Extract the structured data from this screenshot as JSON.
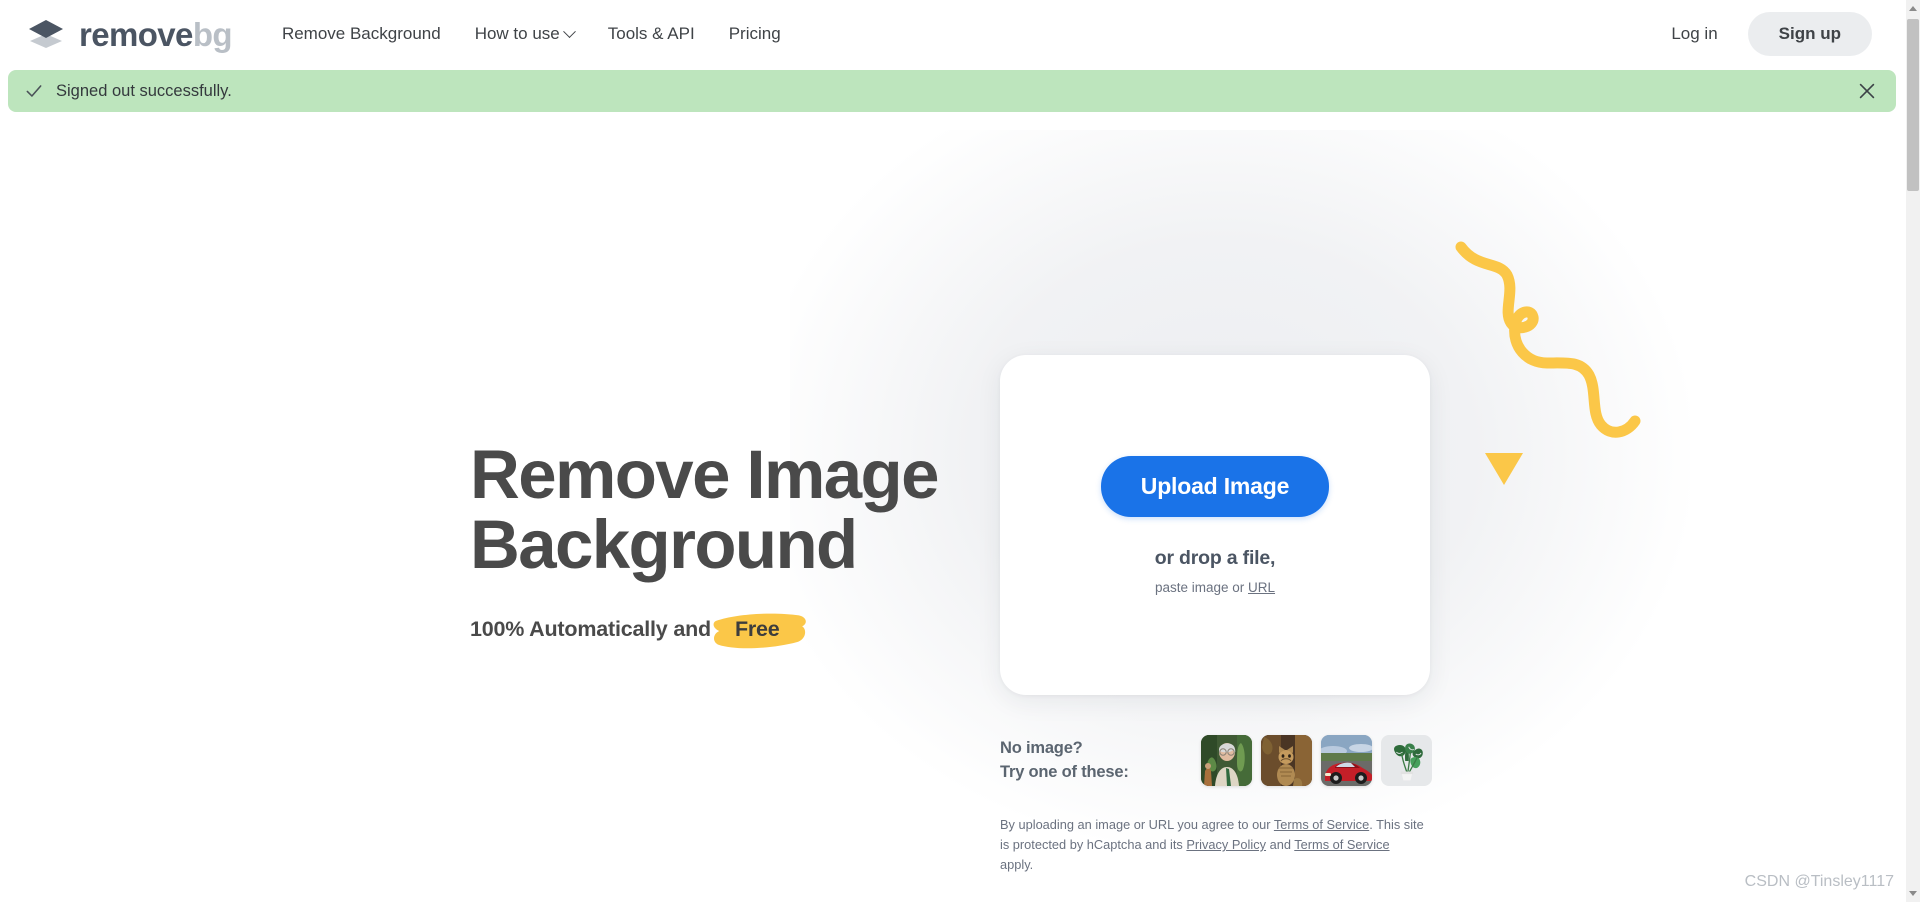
{
  "header": {
    "logo": {
      "icon": "layers-diamond-icon",
      "text_primary": "remove",
      "text_secondary": "bg"
    },
    "nav": [
      {
        "label": "Remove Background",
        "has_chevron": false
      },
      {
        "label": "How to use",
        "has_chevron": true
      },
      {
        "label": "Tools & API",
        "has_chevron": false
      },
      {
        "label": "Pricing",
        "has_chevron": false
      }
    ],
    "login_label": "Log in",
    "signup_label": "Sign up"
  },
  "flash": {
    "icon": "check-icon",
    "message": "Signed out successfully.",
    "close_icon": "close-icon",
    "background_color": "#bde5bd"
  },
  "hero": {
    "title_line1": "Remove Image",
    "title_line2": "Background",
    "subtitle_prefix": "100% Automatically and",
    "badge_label": "Free",
    "badge_color": "#fbc748"
  },
  "upload": {
    "button_label": "Upload Image",
    "button_color": "#1a73e8",
    "drop_text": "or drop a file,",
    "paste_prefix": "paste image or ",
    "paste_link": "URL"
  },
  "samples": {
    "label_line1": "No image?",
    "label_line2": "Try one of these:",
    "thumbnails": [
      {
        "name": "sample-man-thumbnail",
        "alt": "man in garden"
      },
      {
        "name": "sample-cat-thumbnail",
        "alt": "cat beside tree"
      },
      {
        "name": "sample-car-thumbnail",
        "alt": "red sports car"
      },
      {
        "name": "sample-plant-thumbnail",
        "alt": "potted monstera plant"
      }
    ]
  },
  "legal": {
    "part1": "By uploading an image or URL you agree to our ",
    "link_terms1": "Terms of Service",
    "part2": ". This site is protected by hCaptcha and its ",
    "link_privacy": "Privacy Policy",
    "part3": " and ",
    "link_terms2": "Terms of Service",
    "part4": " apply."
  },
  "decoration": {
    "name": "yellow-squiggle-and-triangle",
    "color": "#fbc748"
  },
  "watermark": {
    "text": "CSDN @Tinsley1117"
  },
  "scrollbar": {
    "up_arrow": "scroll-up-arrow",
    "down_arrow": "scroll-down-arrow"
  }
}
